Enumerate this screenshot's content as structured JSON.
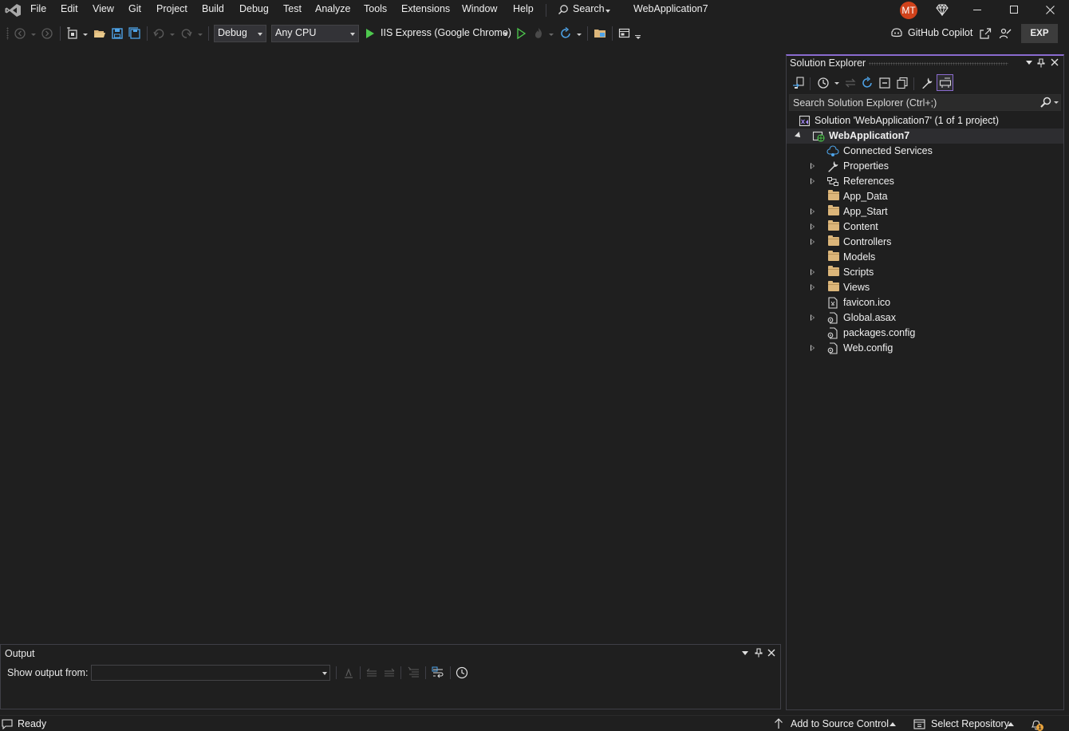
{
  "menu": {
    "items": [
      "File",
      "Edit",
      "View",
      "Git",
      "Project",
      "Build",
      "Debug",
      "Test",
      "Analyze",
      "Tools",
      "Extensions",
      "Window",
      "Help"
    ],
    "search_label": "Search",
    "solution_title": "WebApplication7",
    "avatar_initials": "MT"
  },
  "toolbar": {
    "configuration": "Debug",
    "platform": "Any CPU",
    "run_target": "IIS Express (Google Chrome)",
    "copilot_label": "GitHub Copilot",
    "exp_badge": "EXP"
  },
  "solution_explorer": {
    "title": "Solution Explorer",
    "search_placeholder": "Search Solution Explorer (Ctrl+;)",
    "solution_label": "Solution 'WebApplication7' (1 of 1 project)",
    "project_label": "WebApplication7",
    "items": [
      {
        "label": "Connected Services",
        "icon": "connected-services-icon",
        "expandable": false
      },
      {
        "label": "Properties",
        "icon": "wrench-icon",
        "expandable": true
      },
      {
        "label": "References",
        "icon": "references-icon",
        "expandable": true
      },
      {
        "label": "App_Data",
        "icon": "folder-icon",
        "expandable": false
      },
      {
        "label": "App_Start",
        "icon": "folder-icon",
        "expandable": true
      },
      {
        "label": "Content",
        "icon": "folder-icon",
        "expandable": true
      },
      {
        "label": "Controllers",
        "icon": "folder-icon",
        "expandable": true
      },
      {
        "label": "Models",
        "icon": "folder-icon",
        "expandable": false
      },
      {
        "label": "Scripts",
        "icon": "folder-icon",
        "expandable": true
      },
      {
        "label": "Views",
        "icon": "folder-icon",
        "expandable": true
      },
      {
        "label": "favicon.ico",
        "icon": "image-file-icon",
        "expandable": false
      },
      {
        "label": "Global.asax",
        "icon": "config-file-icon",
        "expandable": true
      },
      {
        "label": "packages.config",
        "icon": "config-file-icon",
        "expandable": false
      },
      {
        "label": "Web.config",
        "icon": "config-file-icon",
        "expandable": true
      }
    ]
  },
  "output": {
    "title": "Output",
    "show_from_label": "Show output from:",
    "selected_source": ""
  },
  "statusbar": {
    "status": "Ready",
    "source_control": "Add to Source Control",
    "repository": "Select Repository",
    "notification_count": "1"
  },
  "colors": {
    "background": "#1f1f1f",
    "accent": "#8a6bcf",
    "avatar": "#d0421b",
    "folder": "#dcb67a",
    "run_green": "#4ec94e",
    "icon_blue": "#4ea3e8"
  }
}
